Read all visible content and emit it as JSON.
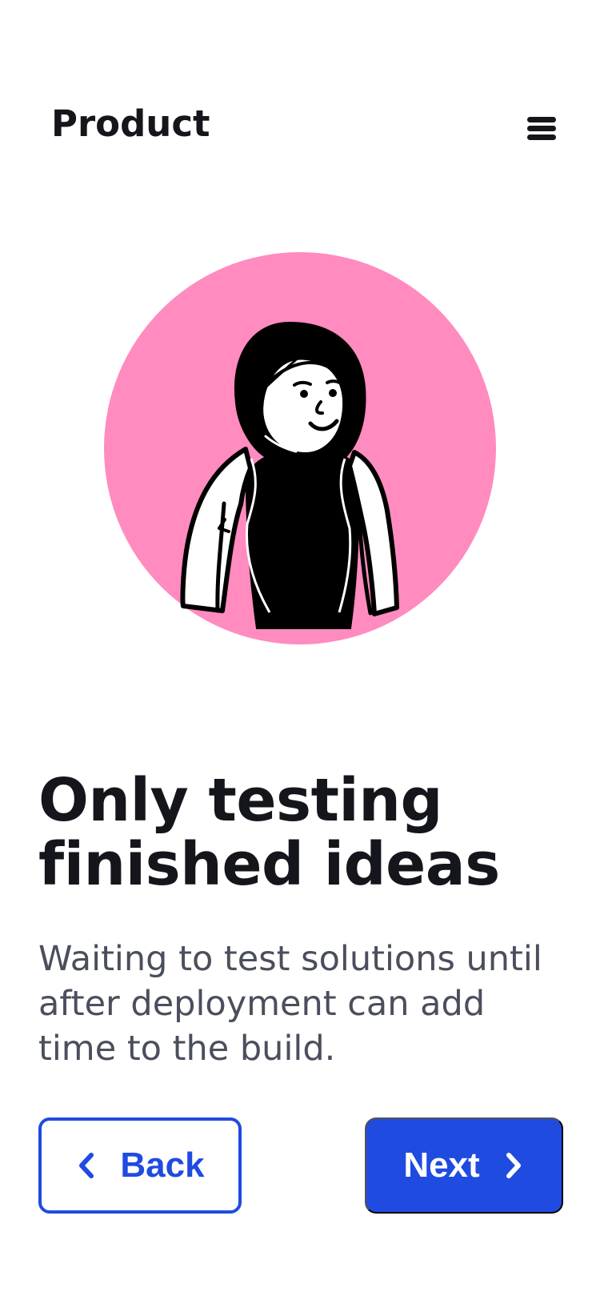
{
  "header": {
    "brand": "Product",
    "menu_icon": "hamburger-menu-icon"
  },
  "hero": {
    "illustration": "woman-in-hijab-illustration",
    "circle_color": "#ff8bbf"
  },
  "content": {
    "headline_line1": "Only testing",
    "headline_line2": "finished ideas",
    "body_line1": "Waiting to test solutions until",
    "body_line2": "after deployment can add",
    "body_line3": "time to the build."
  },
  "actions": {
    "back_label": "Back",
    "back_icon": "chevron-left-icon",
    "next_label": "Next",
    "next_icon": "chevron-right-icon"
  },
  "colors": {
    "primary": "#1f4be0",
    "text": "#15161c",
    "muted_text": "#4b4e5c"
  }
}
